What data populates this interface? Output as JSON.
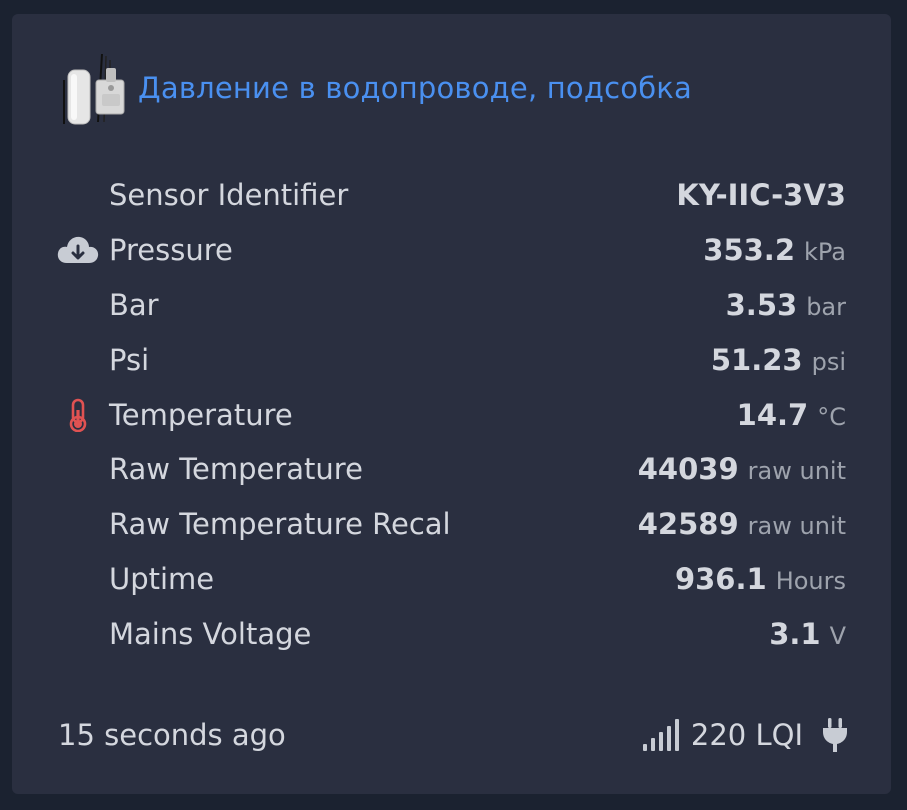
{
  "card": {
    "title": "Давление в водопроводе, подсобка",
    "image_icon": "device-thumbnail"
  },
  "rows": [
    {
      "label": "Sensor Identifier",
      "value": "KY-IIC-3V3",
      "unit": "",
      "icon": ""
    },
    {
      "label": "Pressure",
      "value": "353.2",
      "unit": "kPa",
      "icon": "cloud-download-icon"
    },
    {
      "label": "Bar",
      "value": "3.53",
      "unit": "bar",
      "icon": ""
    },
    {
      "label": "Psi",
      "value": "51.23",
      "unit": "psi",
      "icon": ""
    },
    {
      "label": "Temperature",
      "value": "14.7",
      "unit": "°C",
      "icon": "thermometer-icon"
    },
    {
      "label": "Raw Temperature",
      "value": "44039",
      "unit": "raw unit",
      "icon": ""
    },
    {
      "label": "Raw Temperature Recal",
      "value": "42589",
      "unit": "raw unit",
      "icon": ""
    },
    {
      "label": "Uptime",
      "value": "936.1",
      "unit": "Hours",
      "icon": ""
    },
    {
      "label": "Mains Voltage",
      "value": "3.1",
      "unit": "V",
      "icon": ""
    }
  ],
  "footer": {
    "last_seen": "15 seconds ago",
    "lqi": "220 LQI",
    "signal_icon": "signal-bars-icon",
    "power_icon": "plug-icon"
  },
  "colors": {
    "background": "#1b2230",
    "card": "#2a2f40",
    "title": "#4a90f0",
    "text": "#d4d7de",
    "unit": "#9ea3ad",
    "thermometer": "#e05252",
    "icon_gray": "#c8ccd4"
  }
}
